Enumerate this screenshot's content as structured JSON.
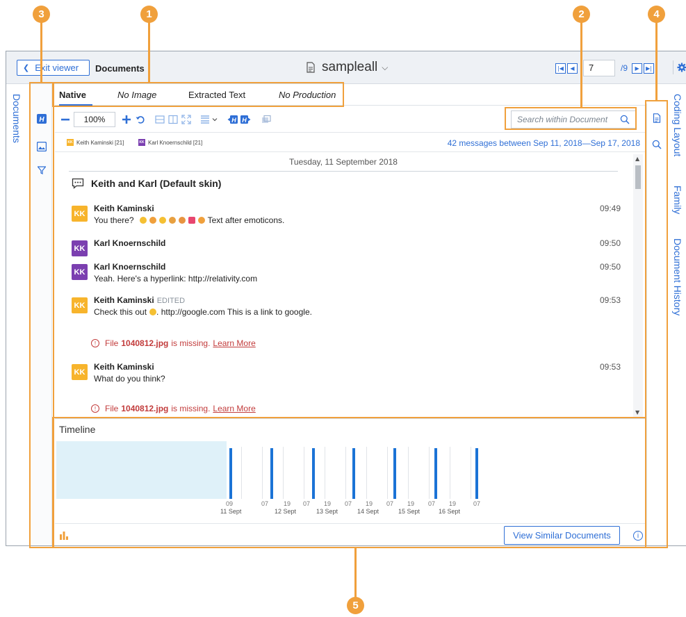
{
  "header": {
    "exit_label": "Exit viewer",
    "documents_label": "Documents",
    "doc_title": "sampleall",
    "page_current": "7",
    "page_total": "/9"
  },
  "left_rail": {
    "label": "Documents"
  },
  "tabs": [
    {
      "label": "Native",
      "active": true
    },
    {
      "label": "No Image"
    },
    {
      "label": "Extracted Text"
    },
    {
      "label": "No Production"
    }
  ],
  "toolbar": {
    "zoom_value": "100%",
    "search_placeholder": "Search within Document"
  },
  "participants": [
    {
      "initials": "KK",
      "label": "Keith Kaminski [21]",
      "color": "#f7b42c"
    },
    {
      "initials": "KK",
      "label": "Karl Knoernschild [21]",
      "color": "#7b3fb0"
    }
  ],
  "message_count": "42 messages between Sep 11, 2018—Sep 17, 2018",
  "conversation": {
    "date": "Tuesday, 11 September 2018",
    "title": "Keith and Karl (Default skin)",
    "messages": [
      {
        "initials": "KK",
        "sender": "Keith Kaminski",
        "time": "09:49",
        "text": "You there?",
        "after": "Text after emoticons."
      },
      {
        "initials": "KK",
        "sender": "Karl Knoernschild",
        "time": "09:50",
        "text": ""
      },
      {
        "initials": "KK",
        "sender": "Karl Knoernschild",
        "time": "09:50",
        "text": "Yeah. Here's a hyperlink: http://relativity.com"
      },
      {
        "initials": "KK",
        "sender": "Keith Kaminski",
        "edited": "EDITED",
        "time": "09:53",
        "text": "Check this out",
        "after": ". http://google.com This is a link to google."
      },
      {
        "initials": "KK",
        "sender": "Keith Kaminski",
        "time": "09:53",
        "text": "What do you think?"
      }
    ],
    "missing_file": {
      "prefix": "File",
      "name": "1040812.jpg",
      "suffix": "is missing.",
      "link": "Learn More"
    }
  },
  "right_rail": {
    "labels": [
      "Coding Layout",
      "Family",
      "Document History"
    ]
  },
  "timeline": {
    "title": "Timeline",
    "ticks": [
      "09",
      "07",
      "19",
      "07",
      "19",
      "07",
      "19",
      "07",
      "19",
      "07",
      "19",
      "07"
    ],
    "days": [
      "11 Sept",
      "12 Sept",
      "13 Sept",
      "14 Sept",
      "15 Sept",
      "16 Sept"
    ],
    "similar_button": "View Similar Documents"
  },
  "callouts": [
    "1",
    "2",
    "3",
    "4",
    "5"
  ],
  "colors": {
    "accent": "#2f6fd6",
    "callout": "#f0a03c",
    "bar": "#1b73d6",
    "error": "#c23b3b"
  }
}
